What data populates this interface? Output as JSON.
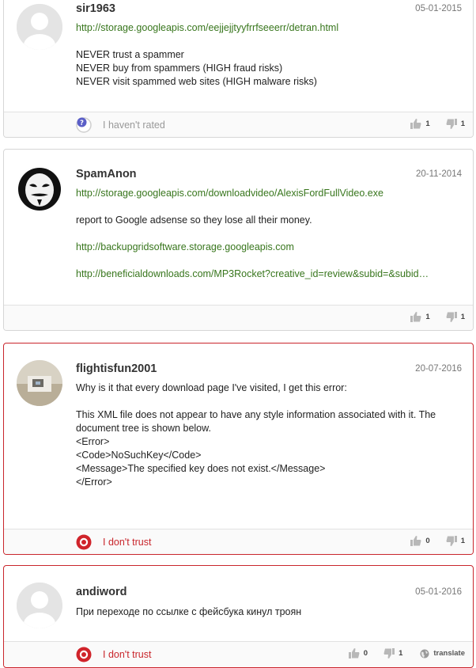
{
  "reviews": [
    {
      "username": "sir1963",
      "date": "05-01-2015",
      "lines": [
        {
          "text": "http://storage.googleapis.com/eejjejjtyyfrrfseeerr/detran.html",
          "link": true
        },
        {
          "text": "",
          "link": false
        },
        {
          "text": "NEVER trust a spammer",
          "link": false
        },
        {
          "text": "NEVER buy from spammers (HIGH fraud risks)",
          "link": false
        },
        {
          "text": "NEVER visit spammed web sites (HIGH malware risks)",
          "link": false
        }
      ],
      "rating_label": "I haven't rated",
      "rating_icon": "question-icon",
      "likes": "1",
      "dislikes": "1"
    },
    {
      "username": "SpamAnon",
      "date": "20-11-2014",
      "lines": [
        {
          "text": "http://storage.googleapis.com/downloadvideo/AlexisFordFullVideo.exe",
          "link": true
        },
        {
          "text": "",
          "link": false
        },
        {
          "text": "report to Google adsense so they lose all their money.",
          "link": false
        },
        {
          "text": "",
          "link": false
        },
        {
          "text": "http://backupgridsoftware.storage.googleapis.com",
          "link": true
        },
        {
          "text": "",
          "link": false
        },
        {
          "text": "http://beneficialdownloads.com/MP3Rocket?creative_id=review&subid=&subid…",
          "link": true
        }
      ],
      "likes": "1",
      "dislikes": "1"
    },
    {
      "username": "flightisfun2001",
      "date": "20-07-2016",
      "lines": [
        {
          "text": "Why is it that every download page I've visited, I get this error:",
          "link": false
        },
        {
          "text": "",
          "link": false
        },
        {
          "text": "This XML file does not appear to have any style information associated with it. The",
          "link": false
        },
        {
          "text": "document tree is shown below.",
          "link": false
        },
        {
          "text": "<Error>",
          "link": false
        },
        {
          "text": "<Code>NoSuchKey</Code>",
          "link": false
        },
        {
          "text": "<Message>The specified key does not exist.</Message>",
          "link": false
        },
        {
          "text": "</Error>",
          "link": false
        }
      ],
      "rating_label": "I don't trust",
      "rating_icon": "distrust-icon",
      "likes": "0",
      "dislikes": "1"
    },
    {
      "username": "andiword",
      "date": "05-01-2016",
      "lines": [
        {
          "text": "При переходе по ссылке с фейсбука кинул троян",
          "link": false
        }
      ],
      "rating_label": "I don't trust",
      "rating_icon": "distrust-icon",
      "likes": "0",
      "dislikes": "1",
      "translate_label": "translate"
    }
  ],
  "colors": {
    "link": "#38761d",
    "distrust": "#c9262c",
    "border": "#d6d6d6"
  }
}
